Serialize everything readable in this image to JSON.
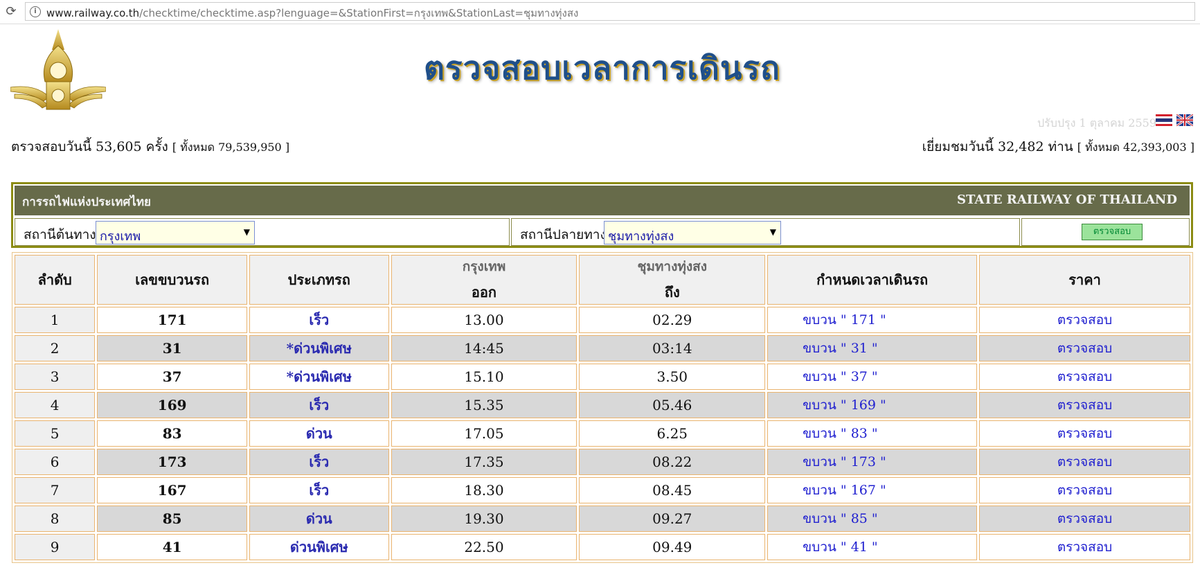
{
  "browser": {
    "url_host": "www.railway.co.th",
    "url_path": "/checktime/checktime.asp?lenguage=&StationFirst=กรุงเทพ&StationLast=ชุมทางทุ่งสง"
  },
  "header": {
    "banner_title": "ตรวจสอบเวลาการเดินรถ",
    "updated": "ปรับปรุง 1 ตุลาคม 2559",
    "stats_left": {
      "label": "ตรวจสอบวันนี้ 53,605 ครั้ง",
      "total": "[ ทั้งหมด  79,539,950  ]"
    },
    "stats_right": {
      "label": "เยี่ยมชมวันนี้ 32,482 ท่าน",
      "total": "[ ทั้งหมด  42,393,003 ]"
    }
  },
  "search": {
    "org_th": "การรถไฟแห่งประเทศไทย",
    "org_en": "STATE RAILWAY OF THAILAND",
    "origin_label": "สถานีต้นทาง",
    "origin_value": "กรุงเทพ",
    "dest_label": "สถานีปลายทาง",
    "dest_value": "ชุมทางทุ่งสง",
    "submit_label": "ตรวจสอบ"
  },
  "table": {
    "headers": {
      "index": "ลำดับ",
      "train_no": "เลขขบวนรถ",
      "type": "ประเภทรถ",
      "origin_station": "กรุงเทพ",
      "origin_sub": "ออก",
      "dest_station": "ชุมทางทุ่งสง",
      "dest_sub": "ถึง",
      "schedule": "กำหนดเวลาเดินรถ",
      "price": "ราคา"
    },
    "rows": [
      {
        "idx": "1",
        "train": "171",
        "type": "เร็ว",
        "dep": "13.00",
        "arr": "02.29",
        "sched": "ขบวน \" 171 \"",
        "price": "ตรวจสอบ"
      },
      {
        "idx": "2",
        "train": "31",
        "type": "*ด่วนพิเศษ",
        "dep": "14:45",
        "arr": "03:14",
        "sched": "ขบวน \" 31 \"",
        "price": "ตรวจสอบ"
      },
      {
        "idx": "3",
        "train": "37",
        "type": "*ด่วนพิเศษ",
        "dep": "15.10",
        "arr": "3.50",
        "sched": "ขบวน \" 37 \"",
        "price": "ตรวจสอบ"
      },
      {
        "idx": "4",
        "train": "169",
        "type": "เร็ว",
        "dep": "15.35",
        "arr": "05.46",
        "sched": "ขบวน \" 169 \"",
        "price": "ตรวจสอบ"
      },
      {
        "idx": "5",
        "train": "83",
        "type": "ด่วน",
        "dep": "17.05",
        "arr": "6.25",
        "sched": "ขบวน \" 83 \"",
        "price": "ตรวจสอบ"
      },
      {
        "idx": "6",
        "train": "173",
        "type": "เร็ว",
        "dep": "17.35",
        "arr": "08.22",
        "sched": "ขบวน \" 173 \"",
        "price": "ตรวจสอบ"
      },
      {
        "idx": "7",
        "train": "167",
        "type": "เร็ว",
        "dep": "18.30",
        "arr": "08.45",
        "sched": "ขบวน \" 167 \"",
        "price": "ตรวจสอบ"
      },
      {
        "idx": "8",
        "train": "85",
        "type": "ด่วน",
        "dep": "19.30",
        "arr": "09.27",
        "sched": "ขบวน \" 85 \"",
        "price": "ตรวจสอบ"
      },
      {
        "idx": "9",
        "train": "41",
        "type": "ด่วนพิเศษ",
        "dep": "22.50",
        "arr": "09.49",
        "sched": "ขบวน \" 41 \"",
        "price": "ตรวจสอบ"
      }
    ]
  },
  "icons": {
    "reload": "reload-icon",
    "info": "info-icon",
    "logo": "railway-emblem-logo",
    "flag_th": "thai-flag-icon",
    "flag_en": "uk-flag-icon"
  }
}
